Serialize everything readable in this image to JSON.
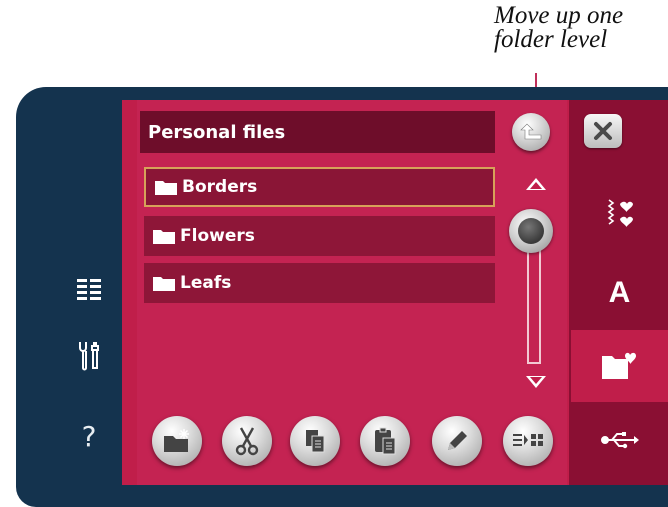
{
  "annotation": {
    "line1": "Move up one",
    "line2": "folder level"
  },
  "panel": {
    "title": "Personal files",
    "folders": [
      {
        "label": "Borders",
        "selected": true
      },
      {
        "label": "Flowers",
        "selected": false
      },
      {
        "label": "Leafs",
        "selected": false
      }
    ]
  },
  "sidebar": {
    "help_label": "?"
  },
  "tabs": {
    "text_tab_label": "A"
  },
  "icons": {
    "left": [
      "list-view-icon",
      "tools-icon",
      "help-icon"
    ],
    "toolbar": [
      "new-folder-icon",
      "cut-icon",
      "copy-icon",
      "paste-icon",
      "rename-icon",
      "view-toggle-icon"
    ],
    "right": [
      "close-icon",
      "stitch-menu-icon",
      "font-icon",
      "file-manager-icon",
      "usb-icon"
    ]
  },
  "colors": {
    "frame": "#14334e",
    "screen": "#c01e4a",
    "title_bar": "#6e0d2a",
    "row": "#8e1638",
    "selected_border": "#d7a259",
    "tab_strip": "#8a0f33",
    "leader_line": "#c0305a"
  }
}
